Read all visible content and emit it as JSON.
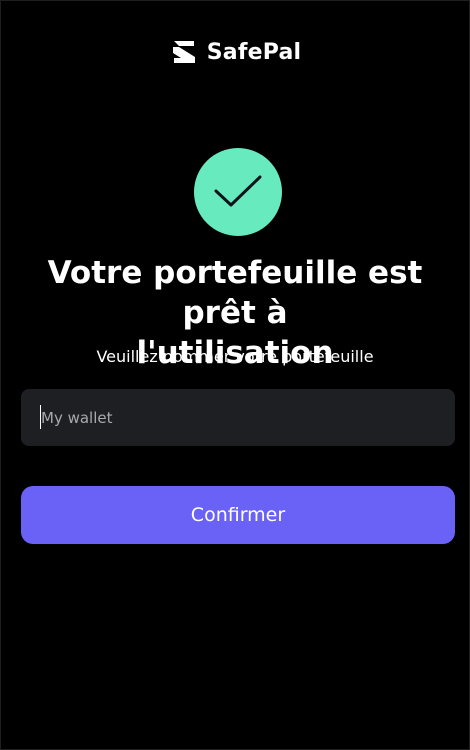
{
  "brand": {
    "name": "SafePal",
    "logo_icon": "safepal-logo-icon"
  },
  "status": {
    "icon": "check-icon",
    "color": "#67ebbe"
  },
  "title": "Votre portefeuille est prêt à\nl'utilisation",
  "subtitle": "Veuillez nommer votre portefeuille",
  "wallet_name_input": {
    "value": "",
    "placeholder": "My wallet"
  },
  "confirm_button": {
    "label": "Confirmer",
    "color": "#6a62f7"
  }
}
